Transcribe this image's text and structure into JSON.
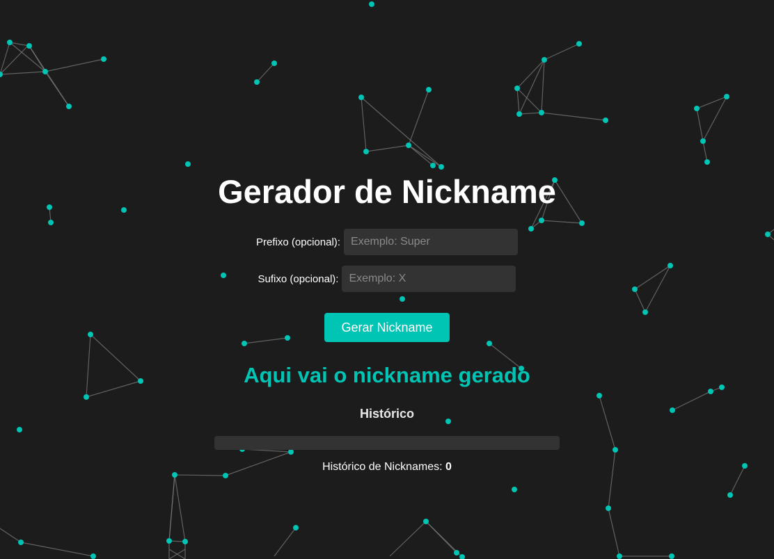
{
  "app": {
    "title": "Gerador de Nickname"
  },
  "form": {
    "prefix_label": "Prefixo (opcional):",
    "prefix_placeholder": "Exemplo: Super",
    "prefix_value": "",
    "suffix_label": "Sufixo (opcional):",
    "suffix_placeholder": "Exemplo: X",
    "suffix_value": "",
    "generate_label": "Gerar Nickname"
  },
  "result": {
    "text": "Aqui vai o nickname gerado"
  },
  "history": {
    "title": "Histórico",
    "items": [],
    "count_label": "Histórico de Nicknames:",
    "count": "0"
  },
  "colors": {
    "background": "#1c1c1c",
    "accent": "#00c4b4",
    "input_bg": "#333333",
    "edge": "#7a7a7a"
  }
}
